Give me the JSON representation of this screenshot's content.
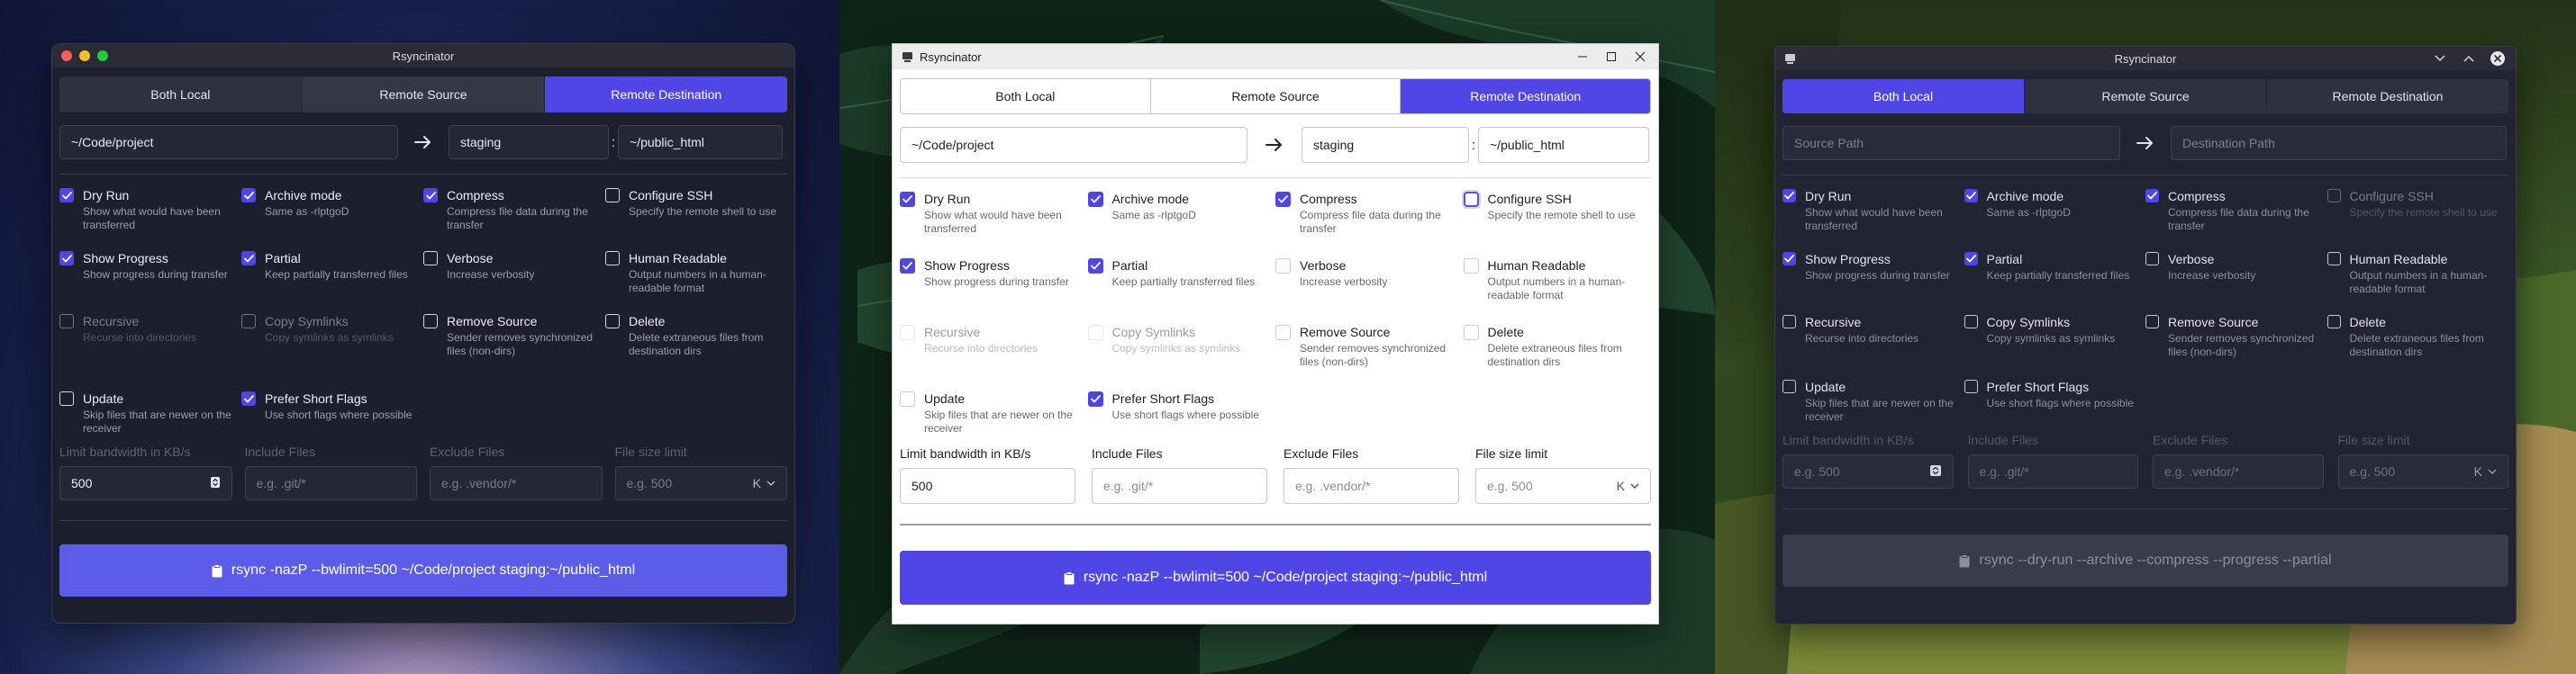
{
  "windows": [
    {
      "title": "Rsyncinator",
      "tabs": [
        "Both Local",
        "Remote Source",
        "Remote Destination"
      ],
      "active_tab": 2,
      "source": {
        "value": "~/Code/project",
        "placeholder": "Source Path"
      },
      "host": {
        "value": "staging"
      },
      "dest": {
        "value": "~/public_html",
        "placeholder": "Destination Path"
      },
      "fields": {
        "bwlimit_label": "Limit bandwidth in KB/s",
        "bwlimit_value": "500",
        "include_label": "Include Files",
        "include_placeholder": "e.g. .git/*",
        "exclude_label": "Exclude Files",
        "exclude_placeholder": "e.g. .vendor/*",
        "filesize_label": "File size limit",
        "filesize_placeholder": "e.g. 500",
        "filesize_unit": "K"
      },
      "command": "rsync -nazP --bwlimit=500 ~/Code/project staging:~/public_html"
    },
    {
      "title": "Rsyncinator",
      "tabs": [
        "Both Local",
        "Remote Source",
        "Remote Destination"
      ],
      "active_tab": 2,
      "source": {
        "value": "~/Code/project",
        "placeholder": "Source Path"
      },
      "host": {
        "value": "staging"
      },
      "dest": {
        "value": "~/public_html",
        "placeholder": "Destination Path"
      },
      "fields": {
        "bwlimit_label": "Limit bandwidth in KB/s",
        "bwlimit_value": "500",
        "include_label": "Include Files",
        "include_placeholder": "e.g. .git/*",
        "exclude_label": "Exclude Files",
        "exclude_placeholder": "e.g. .vendor/*",
        "filesize_label": "File size limit",
        "filesize_placeholder": "e.g. 500",
        "filesize_unit": "K"
      },
      "command": "rsync -nazP --bwlimit=500 ~/Code/project staging:~/public_html"
    },
    {
      "title": "Rsyncinator",
      "tabs": [
        "Both Local",
        "Remote Source",
        "Remote Destination"
      ],
      "active_tab": 0,
      "source": {
        "value": "",
        "placeholder": "Source Path"
      },
      "dest": {
        "value": "",
        "placeholder": "Destination Path"
      },
      "fields": {
        "bwlimit_label": "Limit bandwidth in KB/s",
        "bwlimit_value": "",
        "bwlimit_placeholder": "e.g. 500",
        "include_label": "Include Files",
        "include_placeholder": "e.g. .git/*",
        "exclude_label": "Exclude Files",
        "exclude_placeholder": "e.g. .vendor/*",
        "filesize_label": "File size limit",
        "filesize_placeholder": "e.g. 500",
        "filesize_unit": "K"
      },
      "command": "rsync --dry-run --archive --compress --progress --partial"
    }
  ],
  "options_w1": [
    {
      "label": "Dry Run",
      "desc": "Show what would have been transferred",
      "checked": true
    },
    {
      "label": "Archive mode",
      "desc": "Same as -rlptgoD",
      "checked": true
    },
    {
      "label": "Compress",
      "desc": "Compress file data during the transfer",
      "checked": true
    },
    {
      "label": "Configure SSH",
      "desc": "Specify the remote shell to use",
      "checked": false
    },
    {
      "label": "Show Progress",
      "desc": "Show progress during transfer",
      "checked": true
    },
    {
      "label": "Partial",
      "desc": "Keep partially transferred files",
      "checked": true
    },
    {
      "label": "Verbose",
      "desc": "Increase verbosity",
      "checked": false
    },
    {
      "label": "Human Readable",
      "desc": "Output numbers in a human-readable format",
      "checked": false
    },
    {
      "label": "Recursive",
      "desc": "Recurse into directories",
      "checked": false,
      "disabled": true
    },
    {
      "label": "Copy Symlinks",
      "desc": "Copy symlinks as symlinks",
      "checked": false,
      "disabled": true
    },
    {
      "label": "Remove Source",
      "desc": "Sender removes synchronized files (non-dirs)",
      "checked": false
    },
    {
      "label": "Delete",
      "desc": "Delete extraneous files from destination dirs",
      "checked": false
    },
    {
      "label": "Update",
      "desc": "Skip files that are newer on the receiver",
      "checked": false
    },
    {
      "label": "Prefer Short Flags",
      "desc": "Use short flags where possible",
      "checked": true
    }
  ],
  "options_w2": [
    {
      "label": "Dry Run",
      "desc": "Show what would have been transferred",
      "checked": true
    },
    {
      "label": "Archive mode",
      "desc": "Same as -rlptgoD",
      "checked": true
    },
    {
      "label": "Compress",
      "desc": "Compress file data during the transfer",
      "checked": true
    },
    {
      "label": "Configure SSH",
      "desc": "Specify the remote shell to use",
      "checked": false,
      "focus": true
    },
    {
      "label": "Show Progress",
      "desc": "Show progress during transfer",
      "checked": true
    },
    {
      "label": "Partial",
      "desc": "Keep partially transferred files",
      "checked": true
    },
    {
      "label": "Verbose",
      "desc": "Increase verbosity",
      "checked": false
    },
    {
      "label": "Human Readable",
      "desc": "Output numbers in a human-readable format",
      "checked": false
    },
    {
      "label": "Recursive",
      "desc": "Recurse into directories",
      "checked": false,
      "disabled": true
    },
    {
      "label": "Copy Symlinks",
      "desc": "Copy symlinks as symlinks",
      "checked": false,
      "disabled": true
    },
    {
      "label": "Remove Source",
      "desc": "Sender removes synchronized files (non-dirs)",
      "checked": false
    },
    {
      "label": "Delete",
      "desc": "Delete extraneous files from destination dirs",
      "checked": false
    },
    {
      "label": "Update",
      "desc": "Skip files that are newer on the receiver",
      "checked": false
    },
    {
      "label": "Prefer Short Flags",
      "desc": "Use short flags where possible",
      "checked": true
    }
  ],
  "options_w3": [
    {
      "label": "Dry Run",
      "desc": "Show what would have been transferred",
      "checked": true
    },
    {
      "label": "Archive mode",
      "desc": "Same as -rlptgoD",
      "checked": true
    },
    {
      "label": "Compress",
      "desc": "Compress file data during the transfer",
      "checked": true
    },
    {
      "label": "Configure SSH",
      "desc": "Specify the remote shell to use",
      "checked": false,
      "disabled": true
    },
    {
      "label": "Show Progress",
      "desc": "Show progress during transfer",
      "checked": true
    },
    {
      "label": "Partial",
      "desc": "Keep partially transferred files",
      "checked": true
    },
    {
      "label": "Verbose",
      "desc": "Increase verbosity",
      "checked": false
    },
    {
      "label": "Human Readable",
      "desc": "Output numbers in a human-readable format",
      "checked": false
    },
    {
      "label": "Recursive",
      "desc": "Recurse into directories",
      "checked": false
    },
    {
      "label": "Copy Symlinks",
      "desc": "Copy symlinks as symlinks",
      "checked": false
    },
    {
      "label": "Remove Source",
      "desc": "Sender removes synchronized files (non-dirs)",
      "checked": false
    },
    {
      "label": "Delete",
      "desc": "Delete extraneous files from destination dirs",
      "checked": false
    },
    {
      "label": "Update",
      "desc": "Skip files that are newer on the receiver",
      "checked": false
    },
    {
      "label": "Prefer Short Flags",
      "desc": "Use short flags where possible",
      "checked": false
    }
  ],
  "icons": {
    "arrow": "arrow-right-icon",
    "clipboard": "clipboard-icon",
    "app": "rsyncinator-app-icon",
    "spinner": "number-stepper-icon",
    "chevron": "chevron-down-icon"
  },
  "colors": {
    "accent": "#4f46e5",
    "mac_close": "#ff5f57",
    "mac_min": "#febc2e",
    "mac_max": "#28c840"
  }
}
